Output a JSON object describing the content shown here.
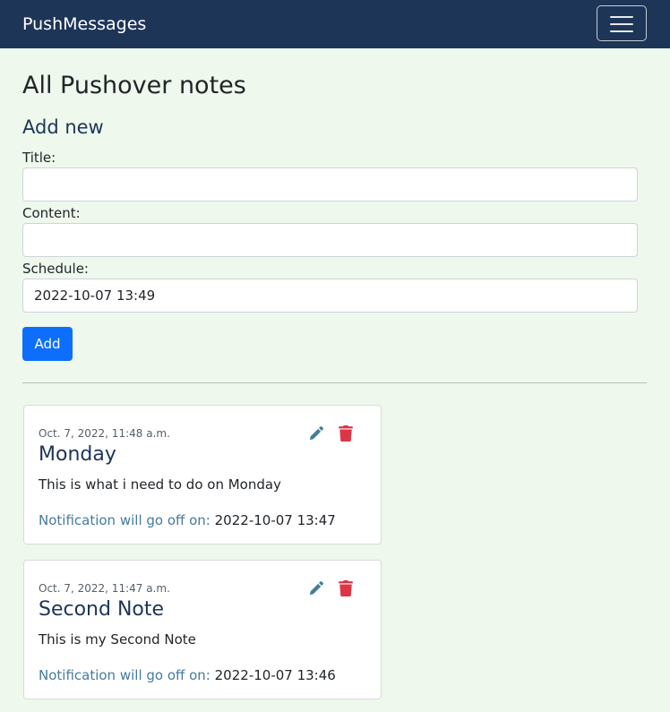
{
  "app": {
    "brand": "PushMessages",
    "colors": {
      "navbar": "#1d3557",
      "background": "#eef8ec",
      "primary_button": "#0d6efd",
      "delete": "#dc3545",
      "edit": "#457b9d"
    }
  },
  "header": {
    "menu_icon": "hamburger-menu-icon"
  },
  "page": {
    "title": "All Pushover notes"
  },
  "form": {
    "heading": "Add new",
    "title_label": "Title:",
    "title_value": "",
    "content_label": "Content:",
    "content_value": "",
    "schedule_label": "Schedule:",
    "schedule_value": "2022-10-07 13:49",
    "add_label": "Add"
  },
  "notes": [
    {
      "date": "Oct. 7, 2022, 11:48 a.m.",
      "title": "Monday",
      "content": "This is what i need to do on Monday",
      "notify_label": "Notification will go off on:",
      "notify_value": "2022-10-07 13:47",
      "edit_icon": "pencil-icon",
      "delete_icon": "trash-icon"
    },
    {
      "date": "Oct. 7, 2022, 11:47 a.m.",
      "title": "Second Note",
      "content": "This is my Second Note",
      "notify_label": "Notification will go off on:",
      "notify_value": "2022-10-07 13:46",
      "edit_icon": "pencil-icon",
      "delete_icon": "trash-icon"
    }
  ]
}
